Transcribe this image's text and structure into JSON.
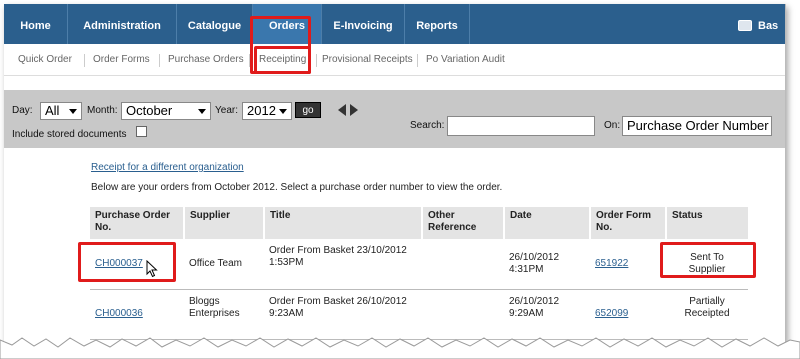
{
  "topnav": {
    "items": [
      {
        "label": "Home"
      },
      {
        "label": "Administration"
      },
      {
        "label": "Catalogue"
      },
      {
        "label": "Orders"
      },
      {
        "label": "E-Invoicing"
      },
      {
        "label": "Reports"
      }
    ],
    "active": "Orders",
    "basket_label": "Bas"
  },
  "subnav": {
    "items": [
      {
        "label": "Quick Order"
      },
      {
        "label": "Order Forms"
      },
      {
        "label": "Purchase Orders"
      },
      {
        "label": "Receipting"
      },
      {
        "label": "Provisional Receipts"
      },
      {
        "label": "Po Variation Audit"
      }
    ],
    "active": "Receipting"
  },
  "filter": {
    "day_label": "Day:",
    "day_value": "All",
    "month_label": "Month:",
    "month_value": "October",
    "year_label": "Year:",
    "year_value": "2012",
    "go_label": "go",
    "include_stored_label": "Include stored documents",
    "search_label": "Search:",
    "search_value": "",
    "on_label": "On:",
    "on_value": "Purchase Order Number"
  },
  "main": {
    "receipt_link": "Receipt for a different organization",
    "intro_text": "Below are your orders from October 2012. Select a purchase order number to view the order.",
    "table": {
      "headers": [
        "Purchase Order No.",
        "Supplier",
        "Title",
        "Other Reference",
        "Date",
        "Order Form No.",
        "Status"
      ],
      "rows": [
        {
          "po": "CH000037",
          "supplier": "Office Team",
          "title": "Order From Basket 23/10/2012 1:53PM",
          "other_ref": "",
          "date": "26/10/2012 4:31PM",
          "form_no": "651922",
          "status": "Sent To Supplier"
        },
        {
          "po": "CH000036",
          "supplier": "Bloggs Enterprises",
          "title": "Order From Basket 26/10/2012 9:23AM",
          "other_ref": "",
          "date": "26/10/2012 9:29AM",
          "form_no": "652099",
          "status": "Partially Receipted"
        }
      ]
    }
  },
  "colors": {
    "nav_bg": "#2b5f8d",
    "nav_active": "#3a77ad",
    "highlight": "#e01b1b",
    "link": "#2a5f8f",
    "filter_bg": "#c8c8c8"
  }
}
